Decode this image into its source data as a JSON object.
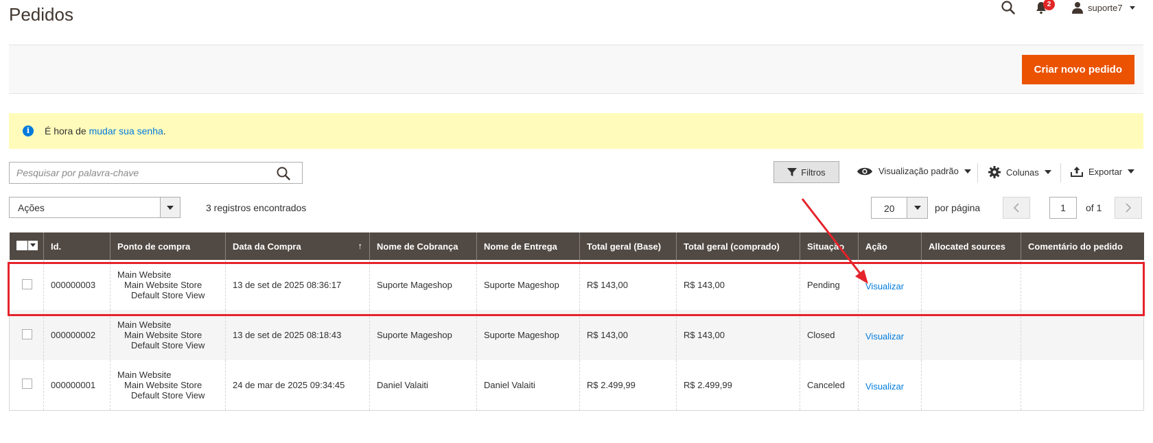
{
  "page": {
    "title": "Pedidos"
  },
  "header": {
    "search_icon": "search-icon",
    "notifications_count": "2",
    "user_name": "suporte7"
  },
  "toolbar": {
    "create_order_label": "Criar novo pedido"
  },
  "message": {
    "prefix": "É hora de ",
    "link": "mudar sua senha",
    "suffix": "."
  },
  "grid_controls": {
    "search_placeholder": "Pesquisar por palavra-chave",
    "filters_label": "Filtros",
    "view_label": "Visualização padrão",
    "columns_label": "Colunas",
    "export_label": "Exportar",
    "actions_label": "Ações",
    "records_found": "3 registros encontrados",
    "per_page_value": "20",
    "per_page_label": "por página",
    "current_page": "1",
    "total_pages": "of 1"
  },
  "table": {
    "headers": [
      "Id.",
      "Ponto de compra",
      "Data da Compra",
      "Nome de Cobrança",
      "Nome de Entrega",
      "Total geral (Base)",
      "Total geral (comprado)",
      "Situação",
      "Ação",
      "Allocated sources",
      "Comentário do pedido"
    ],
    "sort_indicator": "↑",
    "rows": [
      {
        "id": "000000003",
        "store": [
          "Main Website",
          "Main Website Store",
          "Default Store View"
        ],
        "date": "13 de set de 2025 08:36:17",
        "billing": "Suporte Mageshop",
        "shipping": "Suporte Mageshop",
        "total_base": "R$ 143,00",
        "total_purchased": "R$ 143,00",
        "status": "Pending",
        "action": "Visualizar",
        "sources": "",
        "comment": ""
      },
      {
        "id": "000000002",
        "store": [
          "Main Website",
          "Main Website Store",
          "Default Store View"
        ],
        "date": "13 de set de 2025 08:18:43",
        "billing": "Suporte Mageshop",
        "shipping": "Suporte Mageshop",
        "total_base": "R$ 143,00",
        "total_purchased": "R$ 143,00",
        "status": "Closed",
        "action": "Visualizar",
        "sources": "",
        "comment": ""
      },
      {
        "id": "000000001",
        "store": [
          "Main Website",
          "Main Website Store",
          "Default Store View"
        ],
        "date": "24 de mar de 2025 09:34:45",
        "billing": "Daniel Valaiti",
        "shipping": "Daniel Valaiti",
        "total_base": "R$ 2.499,99",
        "total_purchased": "R$ 2.499,99",
        "status": "Canceled",
        "action": "Visualizar",
        "sources": "",
        "comment": ""
      }
    ]
  },
  "colors": {
    "accent": "#eb5202",
    "header_bg": "#514943",
    "link": "#007bdb",
    "annotation": "#e5232b",
    "message_bg": "#fffbbb"
  }
}
